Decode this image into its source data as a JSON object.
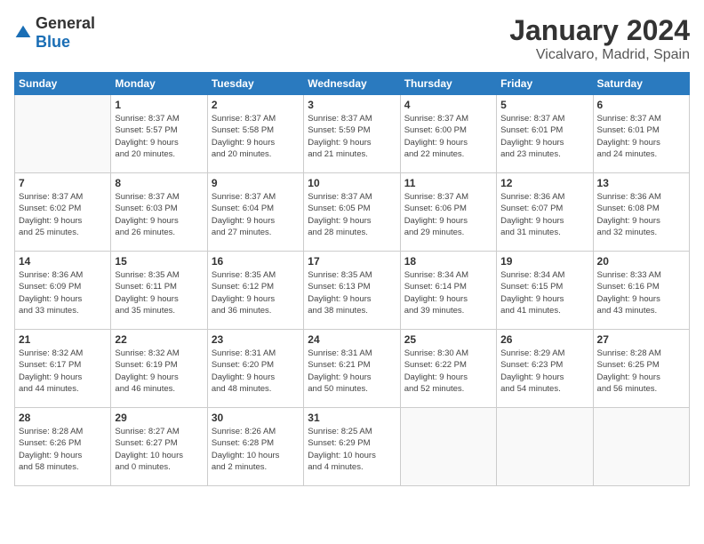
{
  "logo": {
    "general": "General",
    "blue": "Blue"
  },
  "header": {
    "month": "January 2024",
    "location": "Vicalvaro, Madrid, Spain"
  },
  "weekdays": [
    "Sunday",
    "Monday",
    "Tuesday",
    "Wednesday",
    "Thursday",
    "Friday",
    "Saturday"
  ],
  "weeks": [
    [
      {
        "day": "",
        "info": ""
      },
      {
        "day": "1",
        "info": "Sunrise: 8:37 AM\nSunset: 5:57 PM\nDaylight: 9 hours\nand 20 minutes."
      },
      {
        "day": "2",
        "info": "Sunrise: 8:37 AM\nSunset: 5:58 PM\nDaylight: 9 hours\nand 20 minutes."
      },
      {
        "day": "3",
        "info": "Sunrise: 8:37 AM\nSunset: 5:59 PM\nDaylight: 9 hours\nand 21 minutes."
      },
      {
        "day": "4",
        "info": "Sunrise: 8:37 AM\nSunset: 6:00 PM\nDaylight: 9 hours\nand 22 minutes."
      },
      {
        "day": "5",
        "info": "Sunrise: 8:37 AM\nSunset: 6:01 PM\nDaylight: 9 hours\nand 23 minutes."
      },
      {
        "day": "6",
        "info": "Sunrise: 8:37 AM\nSunset: 6:01 PM\nDaylight: 9 hours\nand 24 minutes."
      }
    ],
    [
      {
        "day": "7",
        "info": "Sunrise: 8:37 AM\nSunset: 6:02 PM\nDaylight: 9 hours\nand 25 minutes."
      },
      {
        "day": "8",
        "info": "Sunrise: 8:37 AM\nSunset: 6:03 PM\nDaylight: 9 hours\nand 26 minutes."
      },
      {
        "day": "9",
        "info": "Sunrise: 8:37 AM\nSunset: 6:04 PM\nDaylight: 9 hours\nand 27 minutes."
      },
      {
        "day": "10",
        "info": "Sunrise: 8:37 AM\nSunset: 6:05 PM\nDaylight: 9 hours\nand 28 minutes."
      },
      {
        "day": "11",
        "info": "Sunrise: 8:37 AM\nSunset: 6:06 PM\nDaylight: 9 hours\nand 29 minutes."
      },
      {
        "day": "12",
        "info": "Sunrise: 8:36 AM\nSunset: 6:07 PM\nDaylight: 9 hours\nand 31 minutes."
      },
      {
        "day": "13",
        "info": "Sunrise: 8:36 AM\nSunset: 6:08 PM\nDaylight: 9 hours\nand 32 minutes."
      }
    ],
    [
      {
        "day": "14",
        "info": "Sunrise: 8:36 AM\nSunset: 6:09 PM\nDaylight: 9 hours\nand 33 minutes."
      },
      {
        "day": "15",
        "info": "Sunrise: 8:35 AM\nSunset: 6:11 PM\nDaylight: 9 hours\nand 35 minutes."
      },
      {
        "day": "16",
        "info": "Sunrise: 8:35 AM\nSunset: 6:12 PM\nDaylight: 9 hours\nand 36 minutes."
      },
      {
        "day": "17",
        "info": "Sunrise: 8:35 AM\nSunset: 6:13 PM\nDaylight: 9 hours\nand 38 minutes."
      },
      {
        "day": "18",
        "info": "Sunrise: 8:34 AM\nSunset: 6:14 PM\nDaylight: 9 hours\nand 39 minutes."
      },
      {
        "day": "19",
        "info": "Sunrise: 8:34 AM\nSunset: 6:15 PM\nDaylight: 9 hours\nand 41 minutes."
      },
      {
        "day": "20",
        "info": "Sunrise: 8:33 AM\nSunset: 6:16 PM\nDaylight: 9 hours\nand 43 minutes."
      }
    ],
    [
      {
        "day": "21",
        "info": "Sunrise: 8:32 AM\nSunset: 6:17 PM\nDaylight: 9 hours\nand 44 minutes."
      },
      {
        "day": "22",
        "info": "Sunrise: 8:32 AM\nSunset: 6:19 PM\nDaylight: 9 hours\nand 46 minutes."
      },
      {
        "day": "23",
        "info": "Sunrise: 8:31 AM\nSunset: 6:20 PM\nDaylight: 9 hours\nand 48 minutes."
      },
      {
        "day": "24",
        "info": "Sunrise: 8:31 AM\nSunset: 6:21 PM\nDaylight: 9 hours\nand 50 minutes."
      },
      {
        "day": "25",
        "info": "Sunrise: 8:30 AM\nSunset: 6:22 PM\nDaylight: 9 hours\nand 52 minutes."
      },
      {
        "day": "26",
        "info": "Sunrise: 8:29 AM\nSunset: 6:23 PM\nDaylight: 9 hours\nand 54 minutes."
      },
      {
        "day": "27",
        "info": "Sunrise: 8:28 AM\nSunset: 6:25 PM\nDaylight: 9 hours\nand 56 minutes."
      }
    ],
    [
      {
        "day": "28",
        "info": "Sunrise: 8:28 AM\nSunset: 6:26 PM\nDaylight: 9 hours\nand 58 minutes."
      },
      {
        "day": "29",
        "info": "Sunrise: 8:27 AM\nSunset: 6:27 PM\nDaylight: 10 hours\nand 0 minutes."
      },
      {
        "day": "30",
        "info": "Sunrise: 8:26 AM\nSunset: 6:28 PM\nDaylight: 10 hours\nand 2 minutes."
      },
      {
        "day": "31",
        "info": "Sunrise: 8:25 AM\nSunset: 6:29 PM\nDaylight: 10 hours\nand 4 minutes."
      },
      {
        "day": "",
        "info": ""
      },
      {
        "day": "",
        "info": ""
      },
      {
        "day": "",
        "info": ""
      }
    ]
  ]
}
